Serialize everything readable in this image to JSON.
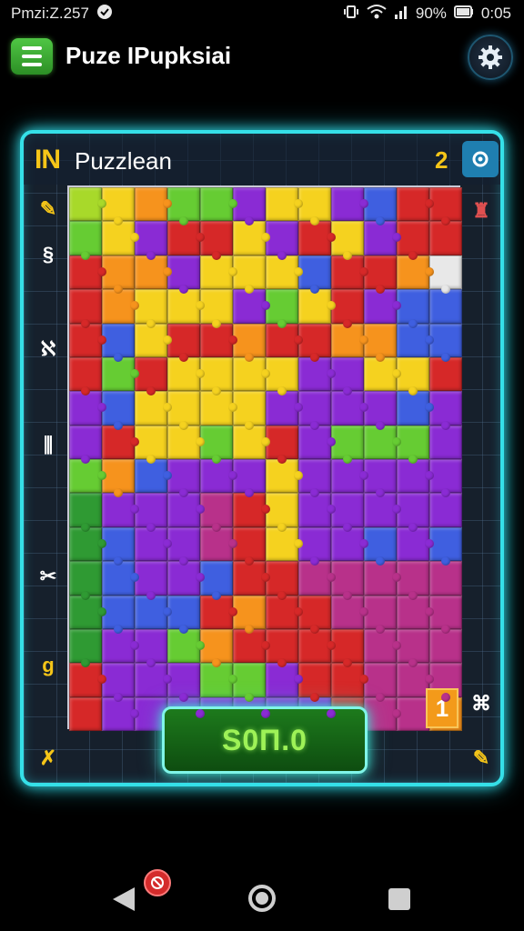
{
  "status_bar": {
    "left_text": "Pmzi:Z.257",
    "battery_text": "90%",
    "time": "0:05",
    "icons": [
      "notification-icon",
      "vibrate-icon",
      "wifi-icon",
      "signal-icon",
      "battery-icon"
    ]
  },
  "header": {
    "title": "Puze IPupksiai",
    "menu_icon": "hamburger-menu-icon",
    "settings_icon": "gear-icon",
    "accent_color": "#3cb83a"
  },
  "board": {
    "logo": "IN",
    "title": "Puzzlean",
    "level": "2",
    "left_icons": [
      {
        "name": "pencil-icon",
        "glyph": "✎",
        "color": "#f5c518"
      },
      {
        "name": "link-icon",
        "glyph": "§",
        "color": "#ffffff"
      },
      {
        "name": "swirl-icon",
        "glyph": "ℵ",
        "color": "#ffffff"
      },
      {
        "name": "bars-icon",
        "glyph": "⫼",
        "color": "#ffffff"
      },
      {
        "name": "scissors-icon",
        "glyph": "✂",
        "color": "#ffffff"
      },
      {
        "name": "rune-icon",
        "glyph": "g",
        "color": "#f5c518"
      },
      {
        "name": "wand-icon",
        "glyph": "✗",
        "color": "#f5c518"
      }
    ],
    "right_icons": [
      {
        "name": "tool-icon",
        "glyph": "♜",
        "color": "#e05050"
      },
      {
        "name": "bug-icon",
        "glyph": "⌘",
        "color": "#ffffff"
      },
      {
        "name": "pencil-ruler-icon",
        "glyph": "✎",
        "color": "#f5c518"
      }
    ],
    "corner_badge": "1",
    "score_button": "S0Π.0",
    "frame_color": "#35e0e8"
  },
  "puzzle": {
    "cols": 12,
    "rows": 16,
    "palette": {
      "g": "#66cc33",
      "y": "#f5d21f",
      "o": "#f6931d",
      "r": "#d62828",
      "p": "#8a2bd4",
      "b": "#3f5fe0",
      "m": "#b8318a",
      "w": "#e8e8e8",
      "l": "#a8d92a",
      "k": "#2f9a33"
    },
    "grid": [
      "lyoggpyypbrr",
      "gyprrypryprr",
      "roopyyybrrow",
      "royyypgyrpbb",
      "rbyrrorroobb",
      "rgryyyyppyyr",
      "pbyyyyppppbp",
      "pryygyrpgggp",
      "gobpppyppppp",
      "kpppmryppppp",
      "kbppmryppbpb",
      "kbppbrrmmmmm",
      "kbbbrorrmmmm",
      "kppgorrrrmmm",
      "rpppggprrmmm",
      "rppppppprmmo"
    ]
  },
  "nav_bar": {
    "back_icon": "back-triangle-icon",
    "home_icon": "home-circle-icon",
    "recents_icon": "recents-square-icon",
    "notification_icon": "block-badge-icon"
  }
}
